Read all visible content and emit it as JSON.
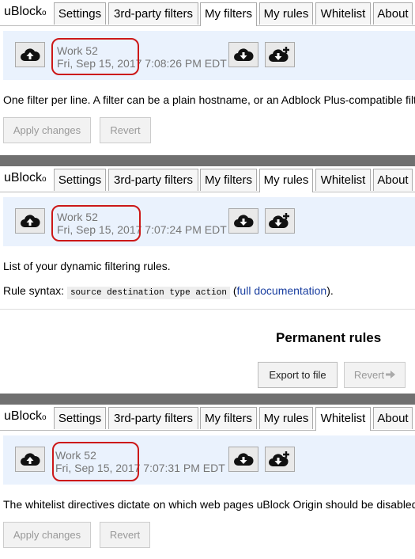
{
  "brand": {
    "name": "uBlock",
    "suffix": "o"
  },
  "tabs": [
    "Settings",
    "3rd-party filters",
    "My filters",
    "My rules",
    "Whitelist",
    "About"
  ],
  "panels": [
    {
      "active_tab": "My filters",
      "backup_name": "Work 52",
      "backup_date": "Fri, Sep 15, 2017",
      "backup_time": "7:08:26 PM EDT",
      "description": "One filter per line. A filter can be a plain hostname, or an Adblock Plus-compatible filter.",
      "apply_label": "Apply changes",
      "revert_label": "Revert"
    },
    {
      "active_tab": "My rules",
      "backup_name": "Work 52",
      "backup_date": "Fri, Sep 15, 2017",
      "backup_time": "7:07:24 PM EDT",
      "description": "List of your dynamic filtering rules.",
      "syntax_label": "Rule syntax:",
      "syntax_code": "source destination type action",
      "doc_link": "full documentation",
      "permanent_heading": "Permanent rules",
      "export_label": "Export to file",
      "revert_label": "Revert"
    },
    {
      "active_tab": "Whitelist",
      "backup_name": "Work 52",
      "backup_date": "Fri, Sep 15, 2017",
      "backup_time": "7:07:31 PM EDT",
      "description": "The whitelist directives dictate on which web pages uBlock Origin should be disabled.",
      "apply_label": "Apply changes",
      "revert_label": "Revert"
    }
  ],
  "icons": {
    "upload": "cloud-upload-icon",
    "download": "cloud-download-icon",
    "download_plus": "cloud-download-plus-icon",
    "arrow": "arrow-right-icon"
  },
  "colors": {
    "highlight_oval": "#cc1818",
    "sync_bg": "#eaf2fd",
    "separator": "#707070",
    "link": "#1a3fa0"
  }
}
